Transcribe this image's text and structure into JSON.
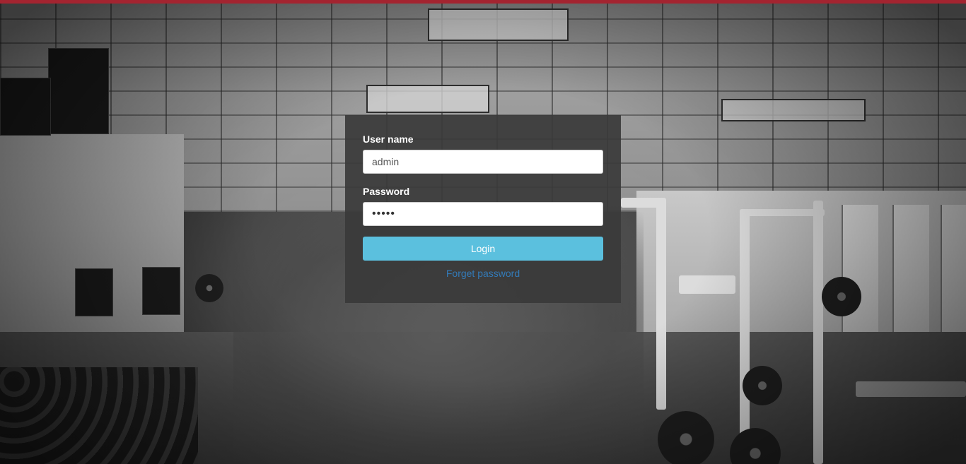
{
  "colors": {
    "top_bar": "#a32430",
    "login_button": "#5bc0de",
    "link": "#337ab7",
    "card_background": "#3a3a3a"
  },
  "login_form": {
    "username_label": "User name",
    "username_value": "admin",
    "password_label": "Password",
    "password_value": "•••••",
    "login_button_label": "Login",
    "forget_password_link": "Forget password"
  }
}
